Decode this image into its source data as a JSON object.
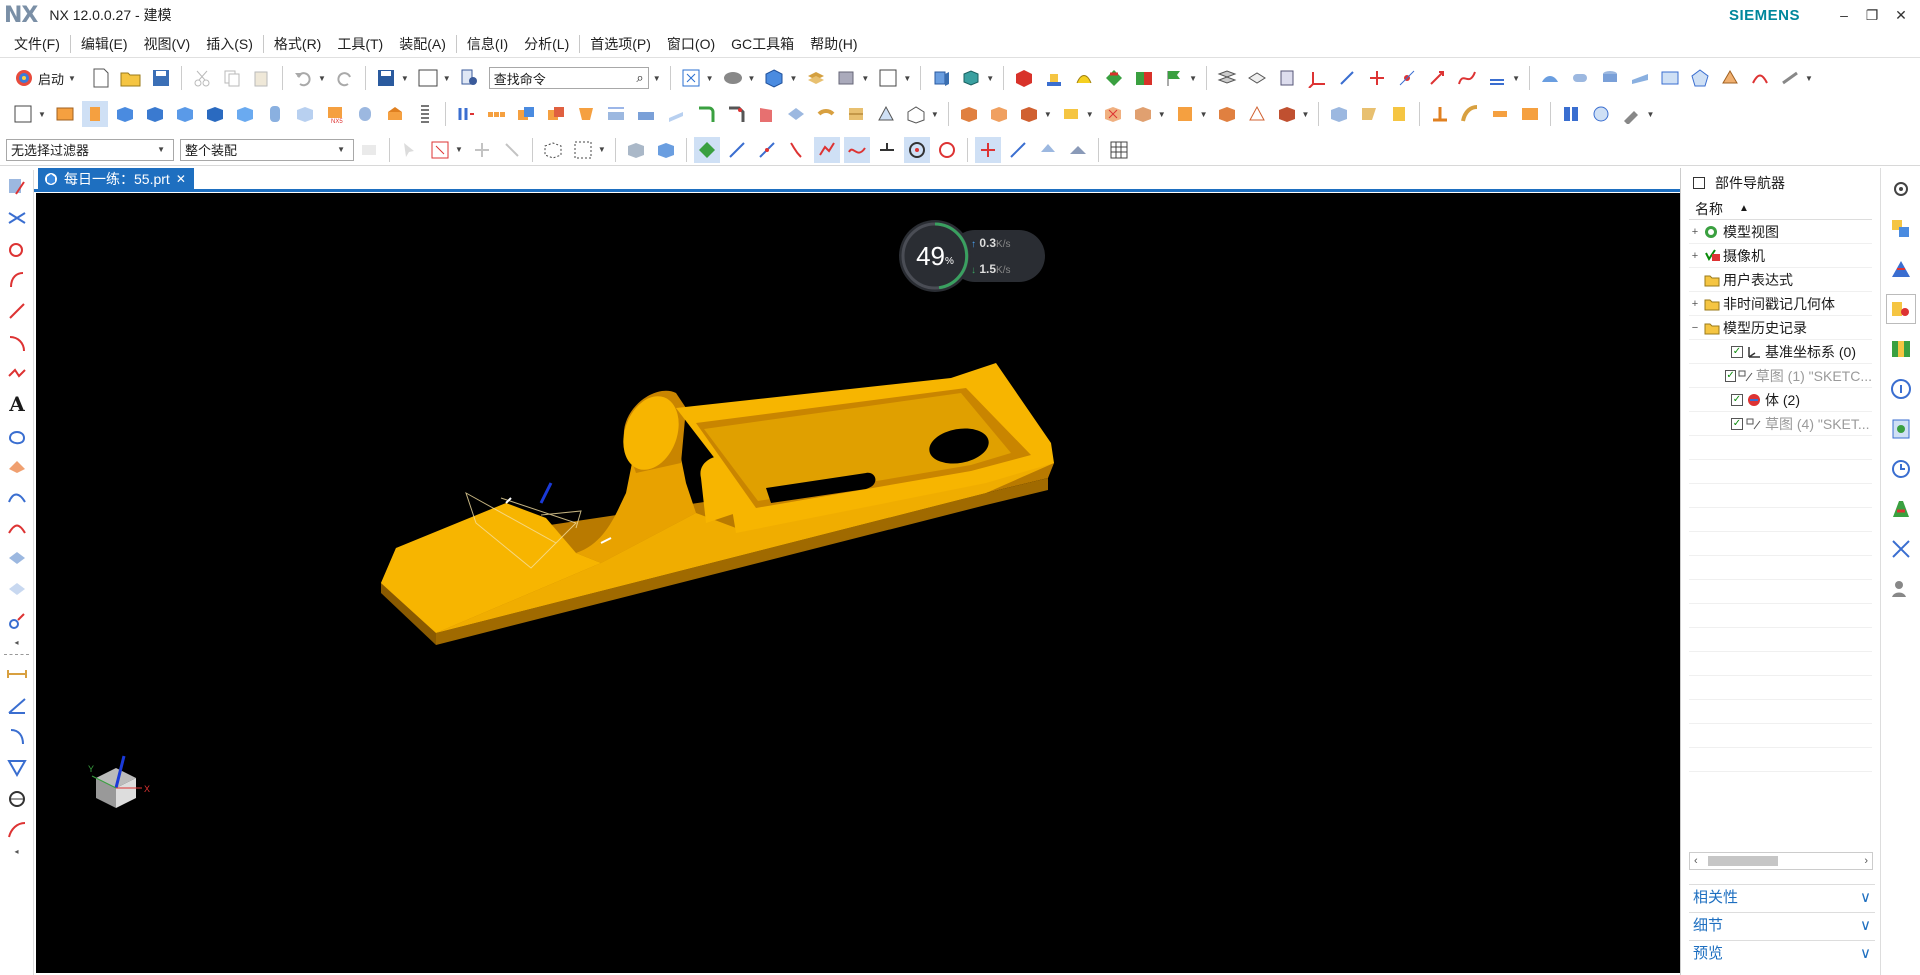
{
  "window": {
    "logo": "NX",
    "title": "NX 12.0.0.27 - 建模",
    "brand": "SIEMENS",
    "controls": [
      "–",
      "❐",
      "✕"
    ]
  },
  "menubar": [
    "文件(F)",
    "编辑(E)",
    "视图(V)",
    "插入(S)",
    "格式(R)",
    "工具(T)",
    "装配(A)",
    "信息(I)",
    "分析(L)",
    "首选项(P)",
    "窗口(O)",
    "GC工具箱",
    "帮助(H)"
  ],
  "toolbar": {
    "start_label": "启动",
    "command_search": "查找命令",
    "selection_filter": "无选择过滤器",
    "assembly_scope": "整个装配"
  },
  "document_tab": {
    "label": "每日一练：55.prt",
    "close": "✕"
  },
  "network_widget": {
    "percent": "49",
    "percent_unit": "%",
    "upload": "0.3",
    "download": "1.5",
    "unit": "K/s"
  },
  "navigator": {
    "title": "部件导航器",
    "column_name": "名称",
    "items": [
      {
        "label": "模型视图",
        "expand": "+",
        "icon": "model-views-icon",
        "dim": false,
        "check": false
      },
      {
        "label": "摄像机",
        "expand": "+",
        "icon": "camera-icon",
        "dim": false,
        "check": false
      },
      {
        "label": "用户表达式",
        "expand": "",
        "icon": "folder-icon",
        "dim": false,
        "check": false
      },
      {
        "label": "非时间戳记几何体",
        "expand": "+",
        "icon": "folder-icon",
        "dim": false,
        "check": false
      },
      {
        "label": "模型历史记录",
        "expand": "−",
        "icon": "folder-open-icon",
        "dim": false,
        "check": false
      },
      {
        "label": "基准坐标系 (0)",
        "expand": "",
        "icon": "datum-csys-icon",
        "dim": false,
        "check": true
      },
      {
        "label": "草图 (1) \"SKETC...",
        "expand": "",
        "icon": "sketch-icon",
        "dim": true,
        "check": true
      },
      {
        "label": "体 (2)",
        "expand": "",
        "icon": "body-icon",
        "dim": false,
        "check": true
      },
      {
        "label": "草图 (4) \"SKET...",
        "expand": "",
        "icon": "sketch-icon",
        "dim": true,
        "check": true
      }
    ],
    "panels": [
      "相关性",
      "细节",
      "预览"
    ]
  },
  "colors": {
    "accent": "#1e6fc0",
    "part_fill": "#f7b500",
    "part_shade": "#b97a00",
    "viewport_bg": "#000000",
    "brand": "#00879c"
  }
}
